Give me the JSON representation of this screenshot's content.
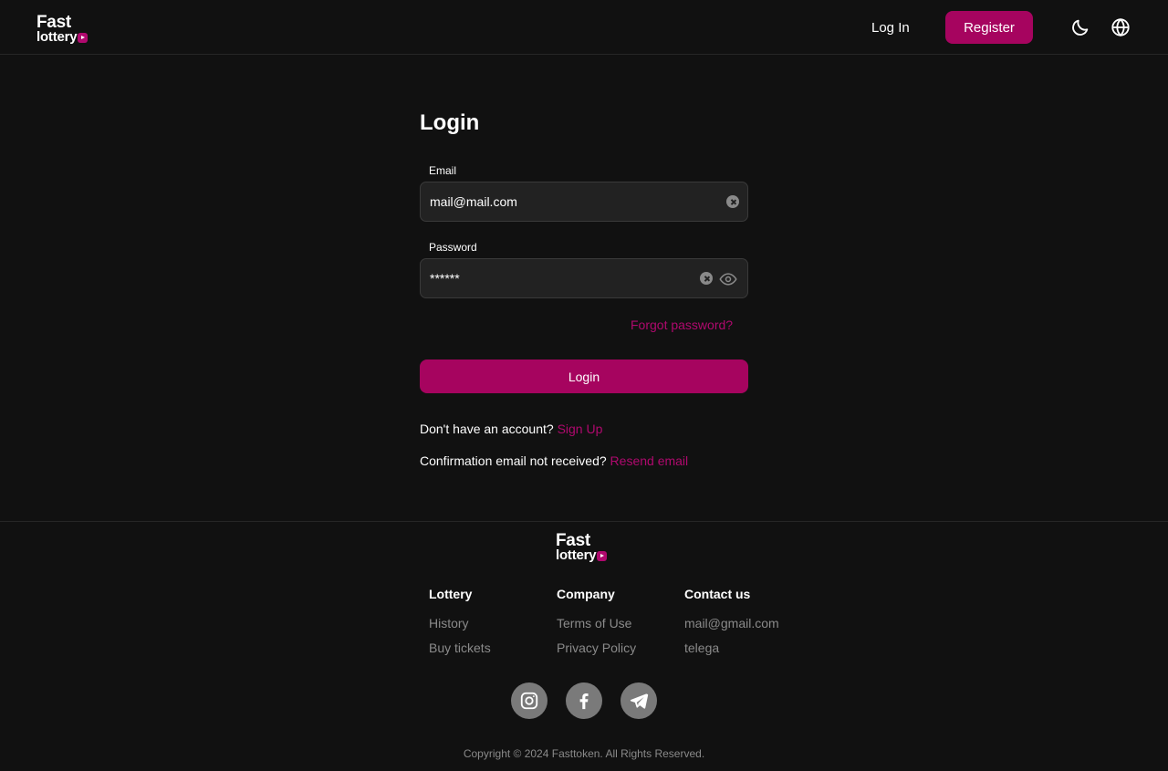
{
  "brand": {
    "line1": "Fast",
    "line2": "lottery"
  },
  "header": {
    "login_label": "Log In",
    "register_label": "Register",
    "icons": [
      "moon-icon",
      "globe-icon"
    ]
  },
  "form": {
    "title": "Login",
    "email_label": "Email",
    "email_value": "mail@mail.com",
    "password_label": "Password",
    "password_value": "******",
    "forgot_label": "Forgot password?",
    "submit_label": "Login",
    "signup_prompt": "Don't have an account?",
    "signup_link": "Sign Up",
    "resend_prompt": "Confirmation email not received?",
    "resend_link": "Resend email"
  },
  "footer": {
    "columns": [
      {
        "title": "Lottery",
        "links": [
          "History",
          "Buy tickets"
        ]
      },
      {
        "title": "Company",
        "links": [
          "Terms of Use",
          "Privacy Policy"
        ]
      },
      {
        "title": "Contact us",
        "links": [
          "mail@gmail.com",
          "telega"
        ]
      }
    ],
    "social": [
      "instagram-icon",
      "facebook-icon",
      "telegram-icon"
    ],
    "copyright": "Copyright © 2024 Fasttoken. All Rights Reserved."
  },
  "colors": {
    "background": "#111111",
    "accent": "#a6045f",
    "link": "#b0096e",
    "input_bg": "#222222",
    "muted": "#8a8a8a"
  }
}
